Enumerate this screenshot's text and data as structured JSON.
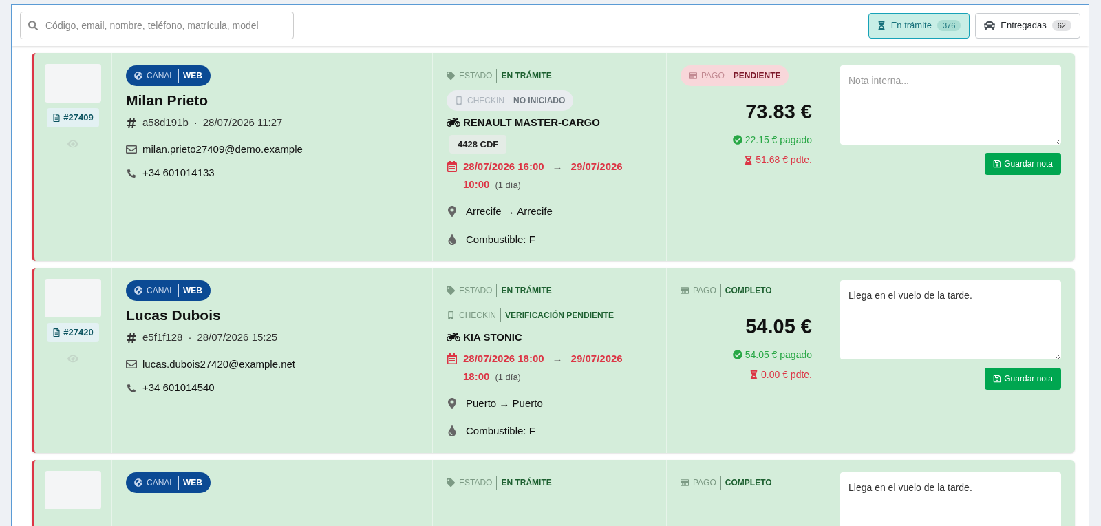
{
  "search": {
    "placeholder": "Código, email, nombre, teléfono, matrícula, model"
  },
  "filters": [
    {
      "label": "En trámite",
      "count": "376",
      "selected": true,
      "kind": "hourglass"
    },
    {
      "label": "Entregadas",
      "count": "62",
      "selected": false,
      "kind": "car"
    }
  ],
  "bookings": [
    {
      "code": "#27409",
      "canal": {
        "label": "CANAL",
        "value": "WEB"
      },
      "name": "Milan Prieto",
      "hash": "a58d191b",
      "separator": "·",
      "created": "28/07/2026 11:27",
      "email": "milan.prieto27409@demo.example",
      "phone": "+34 601014133",
      "estado": {
        "label": "ESTADO",
        "value": "EN TRÁMITE"
      },
      "checkin": {
        "label": "CHECKIN",
        "value": "NO INICIADO",
        "kind": "neutral"
      },
      "vehicle": "RENAULT MASTER-CARGO",
      "plate": "4428 CDF",
      "start": "28/07/2026 16:00",
      "arrow": "→",
      "end": "29/07/2026 10:00",
      "duration": "(1 día)",
      "route": "Arrecife → Arrecife",
      "fuel": "Combustible: F",
      "pago": {
        "label": "PAGO",
        "value": "PENDIENTE",
        "kind": "danger"
      },
      "total": "73.83 €",
      "paid": "22.15 € pagado",
      "pending": "51.68 € pdte.",
      "note": {
        "placeholder": "Nota interna..."
      },
      "save_label": "Guardar nota"
    },
    {
      "code": "#27420",
      "canal": {
        "label": "CANAL",
        "value": "WEB"
      },
      "name": "Lucas Dubois",
      "hash": "e5f1f128",
      "separator": "·",
      "created": "28/07/2026 15:25",
      "email": "lucas.dubois27420@example.net",
      "phone": "+34 601014540",
      "estado": {
        "label": "ESTADO",
        "value": "EN TRÁMITE"
      },
      "checkin": {
        "label": "CHECKIN",
        "value": "VERIFICACIÓN PENDIENTE",
        "kind": "success"
      },
      "vehicle": "KIA STONIC",
      "start": "28/07/2026 18:00",
      "arrow": "→",
      "end": "29/07/2026 18:00",
      "duration": "(1 día)",
      "route": "Puerto → Puerto",
      "fuel": "Combustible: F",
      "pago": {
        "label": "PAGO",
        "value": "COMPLETO",
        "kind": "success"
      },
      "total": "54.05 €",
      "paid": "54.05 € pagado",
      "pending": "0.00 € pdte.",
      "note": {
        "value": "Llega en el vuelo de la tarde."
      },
      "save_label": "Guardar nota"
    },
    {
      "canal": {
        "label": "CANAL",
        "value": "WEB"
      },
      "estado": {
        "label": "ESTADO",
        "value": "EN TRÁMITE"
      },
      "pago": {
        "label": "PAGO",
        "value": "COMPLETO",
        "kind": "success"
      },
      "note": {
        "value": "Llega en el vuelo de la tarde."
      }
    }
  ]
}
